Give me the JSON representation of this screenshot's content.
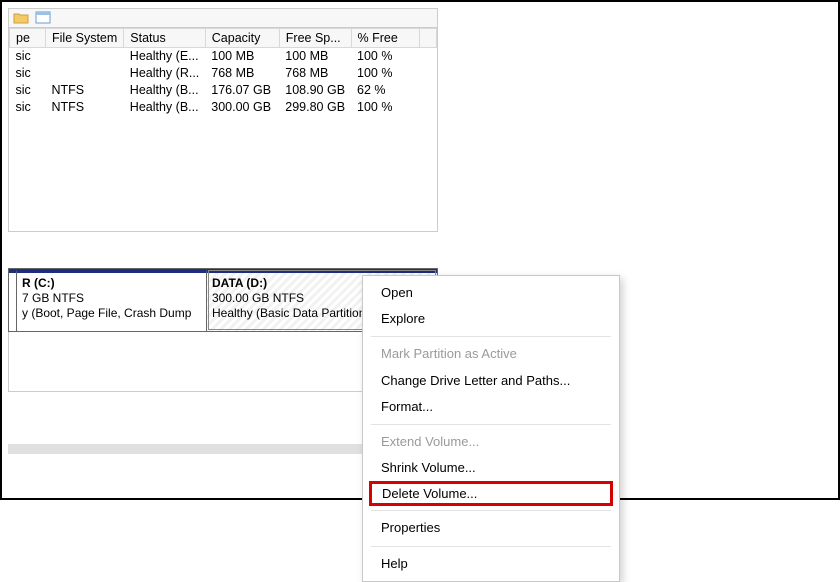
{
  "columns": {
    "type": "pe",
    "fs": "File System",
    "status": "Status",
    "capacity": "Capacity",
    "free": "Free Sp...",
    "pct": "% Free"
  },
  "rows": [
    {
      "type": "sic",
      "fs": "",
      "status": "Healthy (E...",
      "capacity": "100 MB",
      "free": "100 MB",
      "pct": "100 %"
    },
    {
      "type": "sic",
      "fs": "",
      "status": "Healthy (R...",
      "capacity": "768 MB",
      "free": "768 MB",
      "pct": "100 %"
    },
    {
      "type": "sic",
      "fs": "NTFS",
      "status": "Healthy (B...",
      "capacity": "176.07 GB",
      "free": "108.90 GB",
      "pct": "62 %"
    },
    {
      "type": "sic",
      "fs": "NTFS",
      "status": "Healthy (B...",
      "capacity": "300.00 GB",
      "free": "299.80 GB",
      "pct": "100 %"
    }
  ],
  "partitions": {
    "c": {
      "title": "R  (C:)",
      "line2": "7 GB NTFS",
      "line3": "y (Boot, Page File, Crash Dump"
    },
    "d": {
      "title": "DATA  (D:)",
      "line2": "300.00 GB NTFS",
      "line3": "Healthy (Basic Data Partition)"
    }
  },
  "menu": {
    "open": "Open",
    "explore": "Explore",
    "mark_active": "Mark Partition as Active",
    "change_letter": "Change Drive Letter and Paths...",
    "format": "Format...",
    "extend": "Extend Volume...",
    "shrink": "Shrink Volume...",
    "delete": "Delete Volume...",
    "properties": "Properties",
    "help": "Help"
  }
}
